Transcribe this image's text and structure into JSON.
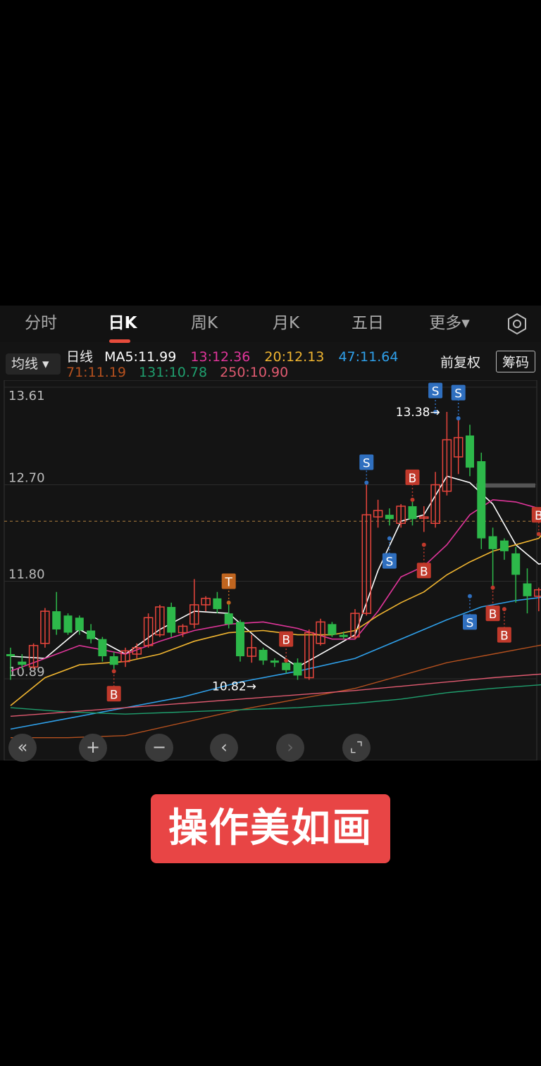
{
  "tabs": [
    {
      "label": "分时",
      "active": false
    },
    {
      "label": "日K",
      "active": true
    },
    {
      "label": "周K",
      "active": false
    },
    {
      "label": "月K",
      "active": false
    },
    {
      "label": "五日",
      "active": false
    },
    {
      "label": "更多▾",
      "active": false
    }
  ],
  "indicator_select": "均线 ▾",
  "ma_header": {
    "prefix": "日线",
    "items": [
      {
        "text": "MA5:11.99",
        "color": "#ffffff"
      },
      {
        "text": "13:12.36",
        "color": "#e0359a"
      },
      {
        "text": "20:12.13",
        "color": "#f0b530"
      },
      {
        "text": "47:11.64",
        "color": "#2fa0ea"
      },
      {
        "text": "71:11.19",
        "color": "#b4501e"
      },
      {
        "text": "131:10.78",
        "color": "#1f9f6e"
      },
      {
        "text": "250:10.90",
        "color": "#e05a70"
      }
    ]
  },
  "adjust_label": "前复权",
  "chips_label": "筹码",
  "banner_text": "操作美如画",
  "colors": {
    "up": "#e8453c",
    "down": "#2db84a",
    "signal_b": "#c0392b",
    "signal_s": "#2f6fbf",
    "signal_t": "#c0651f"
  },
  "chart_data": {
    "type": "candlestick",
    "y_ticks": [
      "13.61",
      "12.70",
      "11.80",
      "10.89"
    ],
    "ylim": [
      10.89,
      13.61
    ],
    "current_price_line": 12.36,
    "annotations": [
      {
        "text": "13.38→",
        "bar": 36,
        "value": 13.38
      },
      {
        "text": "10.82→",
        "bar": 20,
        "value": 10.82
      }
    ],
    "candles": [
      [
        11.12,
        11.18,
        10.88,
        11.1
      ],
      [
        11.05,
        11.12,
        10.98,
        11.02
      ],
      [
        11.0,
        11.22,
        10.98,
        11.2
      ],
      [
        11.22,
        11.55,
        11.18,
        11.52
      ],
      [
        11.52,
        11.7,
        11.3,
        11.35
      ],
      [
        11.48,
        11.5,
        11.3,
        11.32
      ],
      [
        11.46,
        11.48,
        11.3,
        11.34
      ],
      [
        11.34,
        11.4,
        11.22,
        11.26
      ],
      [
        11.26,
        11.28,
        11.05,
        11.1
      ],
      [
        11.1,
        11.14,
        10.98,
        11.02
      ],
      [
        11.05,
        11.18,
        11.0,
        11.15
      ],
      [
        11.12,
        11.22,
        11.08,
        11.18
      ],
      [
        11.2,
        11.5,
        11.18,
        11.46
      ],
      [
        11.3,
        11.58,
        11.28,
        11.56
      ],
      [
        11.56,
        11.6,
        11.28,
        11.32
      ],
      [
        11.32,
        11.4,
        11.28,
        11.38
      ],
      [
        11.4,
        11.82,
        11.36,
        11.58
      ],
      [
        11.58,
        11.66,
        11.52,
        11.64
      ],
      [
        11.64,
        11.7,
        11.5,
        11.54
      ],
      [
        11.5,
        11.58,
        11.36,
        11.4
      ],
      [
        11.42,
        11.44,
        11.05,
        11.1
      ],
      [
        11.1,
        11.3,
        11.04,
        11.18
      ],
      [
        11.16,
        11.18,
        11.02,
        11.06
      ],
      [
        11.06,
        11.08,
        11.0,
        11.04
      ],
      [
        11.04,
        11.08,
        10.94,
        10.97
      ],
      [
        11.04,
        11.08,
        10.88,
        10.92
      ],
      [
        10.9,
        11.35,
        10.88,
        11.32
      ],
      [
        11.22,
        11.45,
        11.2,
        11.42
      ],
      [
        11.4,
        11.42,
        11.28,
        11.3
      ],
      [
        11.3,
        11.33,
        11.26,
        11.28
      ],
      [
        11.28,
        11.54,
        11.26,
        11.5
      ],
      [
        11.5,
        12.72,
        11.48,
        12.42
      ],
      [
        12.4,
        12.56,
        12.3,
        12.46
      ],
      [
        12.42,
        12.48,
        12.32,
        12.38
      ],
      [
        12.34,
        12.52,
        12.3,
        12.5
      ],
      [
        12.5,
        12.54,
        12.32,
        12.38
      ],
      [
        12.4,
        12.5,
        12.26,
        12.4
      ],
      [
        12.34,
        12.82,
        12.3,
        12.7
      ],
      [
        12.64,
        13.38,
        12.6,
        13.12
      ],
      [
        12.96,
        13.32,
        12.8,
        13.14
      ],
      [
        13.16,
        13.26,
        12.78,
        12.86
      ],
      [
        12.92,
        13.0,
        12.1,
        12.2
      ],
      [
        12.22,
        12.3,
        11.72,
        12.1
      ],
      [
        12.18,
        12.2,
        12.0,
        12.08
      ],
      [
        12.06,
        12.12,
        11.6,
        11.86
      ],
      [
        11.78,
        11.92,
        11.5,
        11.66
      ],
      [
        11.66,
        11.74,
        11.52,
        11.72
      ],
      [
        11.72,
        12.38,
        11.62,
        12.3
      ]
    ],
    "ma_series": [
      {
        "label": "MA5",
        "color": "#ffffff",
        "width": 1.6,
        "points": [
          [
            0,
            11.1
          ],
          [
            3,
            11.08
          ],
          [
            6,
            11.35
          ],
          [
            10,
            11.12
          ],
          [
            13,
            11.35
          ],
          [
            16,
            11.52
          ],
          [
            19,
            11.5
          ],
          [
            22,
            11.22
          ],
          [
            25,
            11.0
          ],
          [
            28,
            11.18
          ],
          [
            30,
            11.3
          ],
          [
            32,
            11.9
          ],
          [
            34,
            12.36
          ],
          [
            36,
            12.42
          ],
          [
            38,
            12.78
          ],
          [
            40,
            12.72
          ],
          [
            42,
            12.52
          ],
          [
            44,
            12.14
          ],
          [
            46,
            11.96
          ],
          [
            47,
            11.98
          ]
        ]
      },
      {
        "label": "13",
        "color": "#e0359a",
        "width": 1.6,
        "points": [
          [
            0,
            10.96
          ],
          [
            3,
            11.08
          ],
          [
            6,
            11.2
          ],
          [
            10,
            11.12
          ],
          [
            13,
            11.24
          ],
          [
            16,
            11.34
          ],
          [
            19,
            11.4
          ],
          [
            22,
            11.42
          ],
          [
            25,
            11.36
          ],
          [
            28,
            11.26
          ],
          [
            30,
            11.26
          ],
          [
            32,
            11.52
          ],
          [
            34,
            11.84
          ],
          [
            36,
            11.94
          ],
          [
            38,
            12.14
          ],
          [
            40,
            12.42
          ],
          [
            42,
            12.56
          ],
          [
            44,
            12.54
          ],
          [
            46,
            12.48
          ],
          [
            47,
            12.46
          ]
        ]
      },
      {
        "label": "20",
        "color": "#f0b530",
        "width": 1.6,
        "points": [
          [
            0,
            10.64
          ],
          [
            3,
            10.9
          ],
          [
            6,
            11.02
          ],
          [
            10,
            11.05
          ],
          [
            13,
            11.12
          ],
          [
            16,
            11.24
          ],
          [
            19,
            11.32
          ],
          [
            22,
            11.34
          ],
          [
            25,
            11.3
          ],
          [
            28,
            11.3
          ],
          [
            30,
            11.34
          ],
          [
            32,
            11.48
          ],
          [
            34,
            11.6
          ],
          [
            36,
            11.7
          ],
          [
            38,
            11.86
          ],
          [
            40,
            11.98
          ],
          [
            42,
            12.08
          ],
          [
            44,
            12.14
          ],
          [
            46,
            12.2
          ],
          [
            47,
            12.32
          ]
        ]
      },
      {
        "label": "47",
        "color": "#2fa0ea",
        "width": 1.6,
        "points": [
          [
            0,
            10.42
          ],
          [
            5,
            10.52
          ],
          [
            10,
            10.62
          ],
          [
            15,
            10.72
          ],
          [
            20,
            10.86
          ],
          [
            25,
            10.96
          ],
          [
            30,
            11.08
          ],
          [
            34,
            11.26
          ],
          [
            38,
            11.44
          ],
          [
            41,
            11.56
          ],
          [
            44,
            11.62
          ],
          [
            47,
            11.66
          ]
        ]
      },
      {
        "label": "71",
        "color": "#b4501e",
        "width": 1.4,
        "points": [
          [
            0,
            10.34
          ],
          [
            5,
            10.34
          ],
          [
            10,
            10.36
          ],
          [
            15,
            10.48
          ],
          [
            20,
            10.6
          ],
          [
            25,
            10.7
          ],
          [
            30,
            10.8
          ],
          [
            34,
            10.92
          ],
          [
            38,
            11.04
          ],
          [
            42,
            11.12
          ],
          [
            47,
            11.22
          ]
        ]
      },
      {
        "label": "131",
        "color": "#1f9f6e",
        "width": 1.4,
        "points": [
          [
            0,
            10.62
          ],
          [
            5,
            10.58
          ],
          [
            10,
            10.56
          ],
          [
            15,
            10.58
          ],
          [
            20,
            10.6
          ],
          [
            25,
            10.62
          ],
          [
            30,
            10.66
          ],
          [
            34,
            10.7
          ],
          [
            38,
            10.76
          ],
          [
            42,
            10.8
          ],
          [
            47,
            10.84
          ]
        ]
      },
      {
        "label": "250",
        "color": "#e05a70",
        "width": 1.4,
        "points": [
          [
            0,
            10.54
          ],
          [
            5,
            10.58
          ],
          [
            10,
            10.62
          ],
          [
            15,
            10.66
          ],
          [
            20,
            10.7
          ],
          [
            25,
            10.74
          ],
          [
            30,
            10.78
          ],
          [
            34,
            10.82
          ],
          [
            38,
            10.86
          ],
          [
            42,
            10.9
          ],
          [
            47,
            10.94
          ]
        ]
      }
    ],
    "signals": [
      {
        "label": "B",
        "bar": 9,
        "value": 10.75,
        "anchor": 10.96
      },
      {
        "label": "T",
        "bar": 19,
        "value": 11.8,
        "anchor": 11.6
      },
      {
        "label": "B",
        "bar": 24,
        "value": 11.26,
        "anchor": 11.06
      },
      {
        "label": "S",
        "bar": 31,
        "value": 12.91,
        "anchor": 12.72
      },
      {
        "label": "S",
        "bar": 33,
        "value": 11.99,
        "anchor": 12.2
      },
      {
        "label": "B",
        "bar": 35,
        "value": 12.77,
        "anchor": 12.56
      },
      {
        "label": "B",
        "bar": 36,
        "value": 11.9,
        "anchor": 12.14
      },
      {
        "label": "S",
        "bar": 37,
        "value": 13.58,
        "anchor": 13.38
      },
      {
        "label": "S",
        "bar": 39,
        "value": 13.56,
        "anchor": 13.32
      },
      {
        "label": "S",
        "bar": 40,
        "value": 11.42,
        "anchor": 11.66
      },
      {
        "label": "B",
        "bar": 42,
        "value": 11.5,
        "anchor": 11.74
      },
      {
        "label": "B",
        "bar": 43,
        "value": 11.3,
        "anchor": 11.54
      },
      {
        "label": "B",
        "bar": 46,
        "value": 12.42,
        "anchor": 12.24
      }
    ]
  }
}
